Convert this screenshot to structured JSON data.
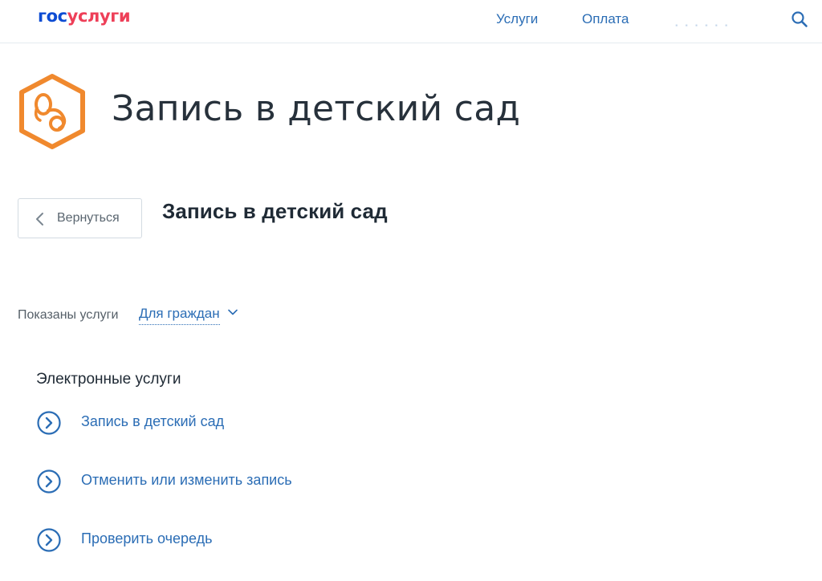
{
  "header": {
    "logo_part1": "гос",
    "logo_part2": "услуги",
    "nav": {
      "uslugi": "Услуги",
      "oplata": "Оплата"
    }
  },
  "title": "Запись в детский сад",
  "back_button_label": "Вернуться",
  "section_title": "Запись в детский сад",
  "filter": {
    "label": "Показаны услуги",
    "selected": "Для граждан"
  },
  "services": {
    "heading": "Электронные услуги",
    "items": [
      {
        "label": "Запись в детский сад"
      },
      {
        "label": "Отменить или изменить запись"
      },
      {
        "label": "Проверить очередь"
      }
    ]
  },
  "colors": {
    "brand_blue": "#0d4cd3",
    "brand_red": "#ee3f58",
    "link_blue": "#2b6db5",
    "accent_orange": "#f0892e"
  }
}
